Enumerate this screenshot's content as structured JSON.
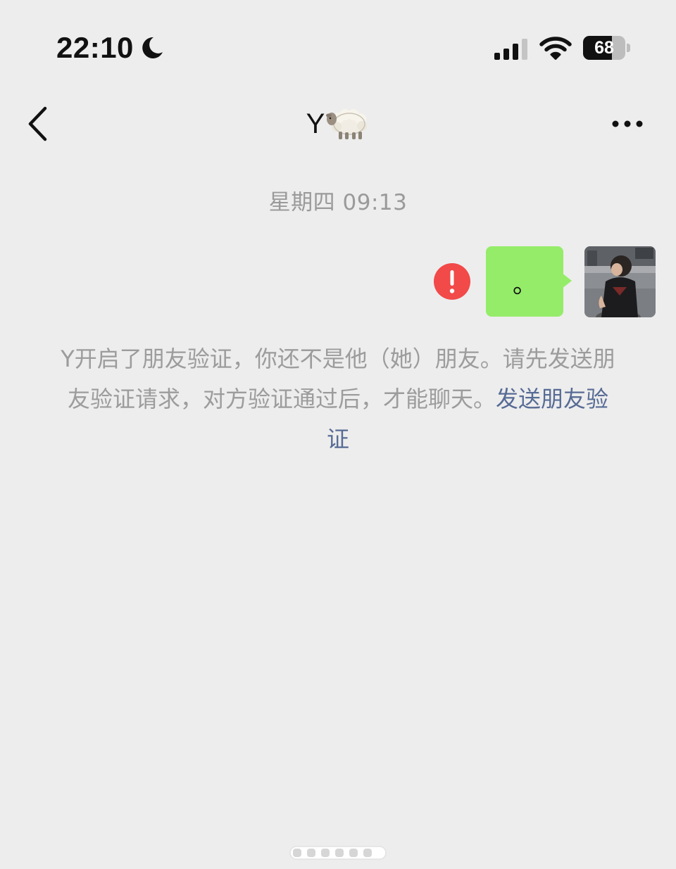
{
  "status_bar": {
    "time": "22:10",
    "battery_level": "68",
    "battery_fraction": 0.68,
    "focus_icon": "moon-icon",
    "signal_icon": "cellular-signal-icon",
    "wifi_icon": "wifi-icon"
  },
  "header": {
    "back_icon": "chevron-left-icon",
    "title": "Y",
    "title_emoji_icon": "sheep-icon",
    "more_icon": "ellipsis-icon"
  },
  "conversation": {
    "timestamp": "星期四 09:13",
    "messages": [
      {
        "direction": "outgoing",
        "text": "。",
        "status": "failed",
        "status_icon": "error-exclamation-icon",
        "avatar": "avatar-photo"
      }
    ],
    "system_notice": {
      "text": "Y开启了朋友验证，你还不是他（她）朋友。请先发送朋友验证请求，对方验证通过后，才能聊天。",
      "link_text": "发送朋友验证"
    }
  },
  "colors": {
    "background": "#ededed",
    "bubble_outgoing": "#95ec69",
    "link": "#576b95",
    "error": "#f24949",
    "muted_text": "#9c9c9c"
  }
}
